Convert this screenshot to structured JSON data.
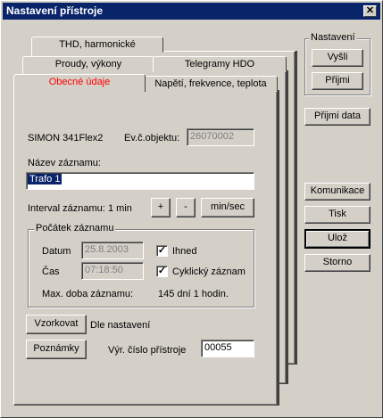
{
  "window": {
    "title": "Nastavení přístroje",
    "close_symbol": "✕"
  },
  "tabs": {
    "row1": [
      "THD, harmonické"
    ],
    "row2": [
      "Proudy, výkony",
      "Telegramy HDO"
    ],
    "row3": [
      "Obecné údaje",
      "Napětí, frekvence, teplota"
    ],
    "active": "Obecné údaje",
    "active_color": "#ff0000"
  },
  "general": {
    "device_name": "SIMON 341Flex2",
    "object_no_label": "Ev.č.objektu:",
    "object_no_value": "26070002",
    "record_name_label": "Název záznamu:",
    "record_name_value": "Trafo 1",
    "interval_label": "Interval záznamu:",
    "interval_value": "1 min",
    "plus_label": "+",
    "minus_label": "-",
    "unit_toggle_label": "min/sec",
    "start_group": {
      "legend": "Počátek záznamu",
      "date_label": "Datum",
      "date_value": "25.8.2003",
      "time_label": "Čas",
      "time_value": "07:18:50",
      "immediately_label": "Ihned",
      "immediately_checked": true,
      "cyclic_label": "Cyklický záznam",
      "cyclic_checked": true,
      "max_duration_label": "Max. doba záznamu:",
      "max_duration_value": "145 dní 1 hodin."
    },
    "sampling_button": "Vzorkovat",
    "sampling_value": "Dle nastavení",
    "notes_button": "Poznámky",
    "serial_label": "Výr. číslo přístroje",
    "serial_value": "00055"
  },
  "side": {
    "nastaveni_legend": "Nastavení",
    "send_button": "Vyšli",
    "receive_button": "Přijmi",
    "receive_data_button": "Přijmi data",
    "comm_button": "Komunikace",
    "print_button": "Tisk",
    "save_button": "Ulož",
    "cancel_button": "Storno"
  }
}
